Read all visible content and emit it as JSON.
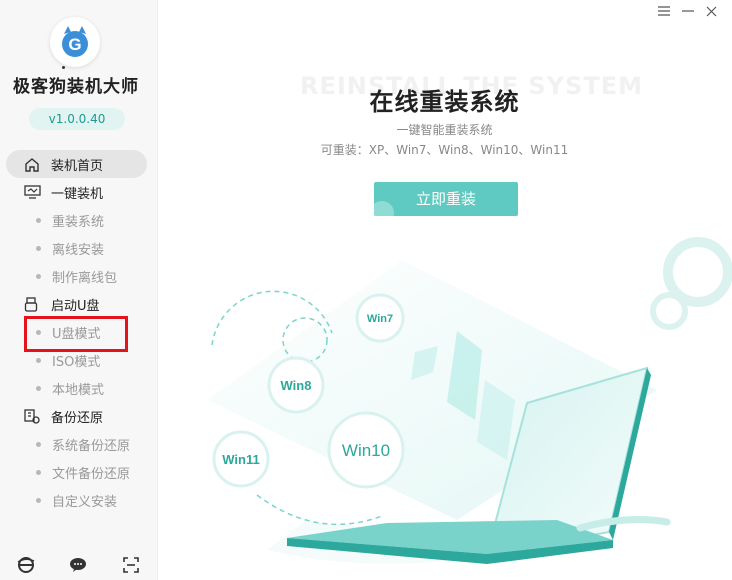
{
  "app": {
    "name": "极客狗装机大师",
    "version": "v1.0.0.40",
    "logo_letter": "G"
  },
  "window_controls": [
    "menu-icon",
    "minimize-icon",
    "close-icon"
  ],
  "nav": {
    "home": "装机首页",
    "one_click": "一键装机",
    "one_click_items": [
      "重装系统",
      "离线安装",
      "制作离线包"
    ],
    "usb": "启动U盘",
    "usb_items": [
      "U盘模式",
      "ISO模式",
      "本地模式"
    ],
    "backup": "备份还原",
    "backup_items": [
      "系统备份还原",
      "文件备份还原",
      "自定义安装"
    ]
  },
  "bottom_icons": [
    "browser-icon",
    "chat-icon",
    "scan-icon"
  ],
  "main": {
    "bg_text": "REINSTALL THE SYSTEM",
    "title": "在线重装系统",
    "subtitle": "一键智能重装系统",
    "os_list": "可重装：XP、Win7、Win8、Win10、Win11",
    "button": "立即重装"
  },
  "bubbles": [
    "Win7",
    "Win8",
    "Win10",
    "Win11"
  ],
  "colors": {
    "accent": "#5fcac1",
    "teal_dark": "#1f9a8f",
    "highlight": "#e4131b"
  }
}
